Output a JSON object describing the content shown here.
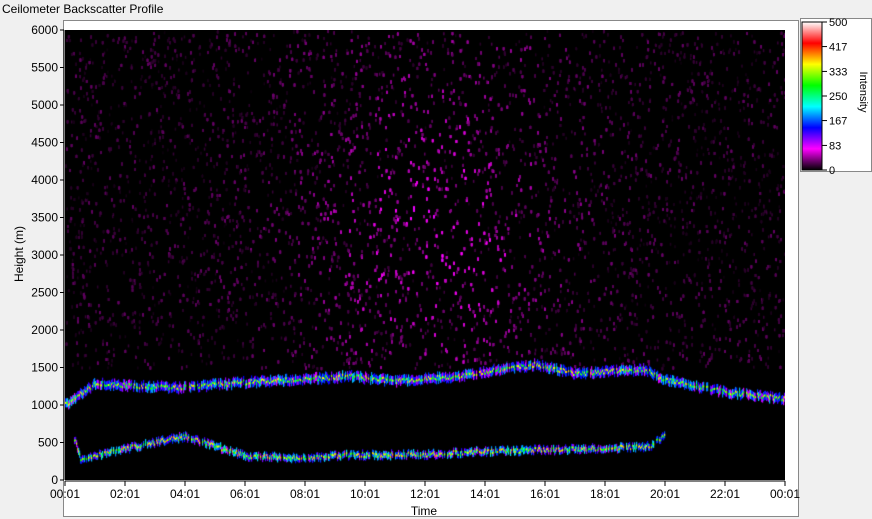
{
  "window_title": "Ceilometer Backscatter Profile",
  "chart_data": {
    "type": "heatmap",
    "title": "Ceilometer Backscatter Profile",
    "xlabel": "Time",
    "ylabel": "Height (m)",
    "x_ticks": [
      "00:01",
      "02:01",
      "04:01",
      "06:01",
      "08:01",
      "10:01",
      "12:01",
      "14:01",
      "16:01",
      "18:01",
      "20:01",
      "22:01",
      "00:01"
    ],
    "y_ticks": [
      0,
      500,
      1000,
      1500,
      2000,
      2500,
      3000,
      3500,
      4000,
      4500,
      5000,
      5500,
      6000
    ],
    "ylim": [
      0,
      6000
    ],
    "colorbar": {
      "label": "Intensity",
      "ticks": [
        0,
        83,
        167,
        250,
        333,
        417,
        500
      ],
      "range": [
        0,
        500
      ],
      "colors": [
        "#000000",
        "#ff00ff",
        "#0000ff",
        "#00ffff",
        "#00ff00",
        "#ffff00",
        "#ff0000",
        "#ffffff"
      ]
    },
    "cloud_layer_upper": [
      {
        "time_h": 0.0,
        "height_m": 1000
      },
      {
        "time_h": 1.0,
        "height_m": 1280
      },
      {
        "time_h": 3.7,
        "height_m": 1230
      },
      {
        "time_h": 6.0,
        "height_m": 1300
      },
      {
        "time_h": 9.5,
        "height_m": 1380
      },
      {
        "time_h": 11.0,
        "height_m": 1320
      },
      {
        "time_h": 13.0,
        "height_m": 1380
      },
      {
        "time_h": 15.7,
        "height_m": 1540
      },
      {
        "time_h": 17.0,
        "height_m": 1420
      },
      {
        "time_h": 19.3,
        "height_m": 1470
      },
      {
        "time_h": 20.0,
        "height_m": 1330
      },
      {
        "time_h": 22.0,
        "height_m": 1170
      },
      {
        "time_h": 24.0,
        "height_m": 1080
      }
    ],
    "cloud_layer_lower": [
      {
        "time_h": 0.3,
        "height_m": 550
      },
      {
        "time_h": 0.5,
        "height_m": 280
      },
      {
        "time_h": 3.3,
        "height_m": 530
      },
      {
        "time_h": 4.0,
        "height_m": 580
      },
      {
        "time_h": 6.0,
        "height_m": 320
      },
      {
        "time_h": 8.0,
        "height_m": 290
      },
      {
        "time_h": 9.2,
        "height_m": 330
      },
      {
        "time_h": 12.0,
        "height_m": 340
      },
      {
        "time_h": 14.0,
        "height_m": 380
      },
      {
        "time_h": 16.0,
        "height_m": 400
      },
      {
        "time_h": 18.0,
        "height_m": 420
      },
      {
        "time_h": 19.5,
        "height_m": 450
      },
      {
        "time_h": 20.0,
        "height_m": 600
      }
    ]
  }
}
